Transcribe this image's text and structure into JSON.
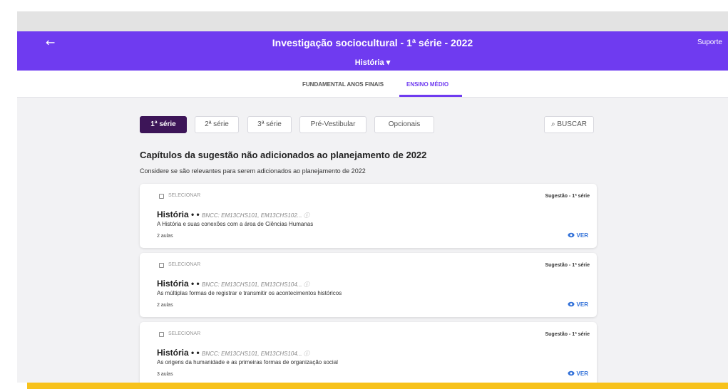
{
  "window": {
    "close_label": "×"
  },
  "header": {
    "back_icon": "arrow-left-icon",
    "back_label": "←",
    "title": "Investigação sociocultural - 1ª série - 2022",
    "support_label": "Suporte",
    "subject_label": "História ▾"
  },
  "level_tabs": [
    {
      "label": "FUNDAMENTAL ANOS FINAIS"
    },
    {
      "label": "ENSINO MÉDIO",
      "active": true
    }
  ],
  "series_tabs": [
    {
      "label": "1ª série",
      "active": true
    },
    {
      "label": "2ª série"
    },
    {
      "label": "3ª série"
    },
    {
      "label": "Pré-Vestibular"
    },
    {
      "label": "Opcionais"
    }
  ],
  "search": {
    "label": "⌕ BUSCAR"
  },
  "section": {
    "title": "Capítulos da sugestão não adicionados ao planejamento de 2022",
    "subtitle": "Considere se são relevantes para serem adicionados ao planejamento de 2022"
  },
  "cards": [
    {
      "select_label": "SELECIONAR",
      "tag": "Sugestão - 1ª série",
      "subject": "História • •",
      "bncc": "BNCC: EM13CHS101, EM13CHS102... ⓘ",
      "description": "A História e suas conexões com a área de Ciências Humanas",
      "lessons": "2 aulas",
      "view_label": "VER"
    },
    {
      "select_label": "SELECIONAR",
      "tag": "Sugestão - 1ª série",
      "subject": "História • •",
      "bncc": "BNCC: EM13CHS101, EM13CHS104... ⓘ",
      "description": "As múltiplas formas de registrar e transmitir os acontecimentos históricos",
      "lessons": "2 aulas",
      "view_label": "VER"
    },
    {
      "select_label": "SELECIONAR",
      "tag": "Sugestão - 1ª série",
      "subject": "História • •",
      "bncc": "BNCC: EM13CHS101, EM13CHS104... ⓘ",
      "description": "As origens da humanidade e as primeiras formas de organização social",
      "lessons": "3 aulas",
      "view_label": "VER"
    }
  ],
  "colors": {
    "header": "#6f3bf0",
    "active_series": "#3d1558",
    "link": "#2f6fd8",
    "bottom_bar": "#f7c21b"
  }
}
